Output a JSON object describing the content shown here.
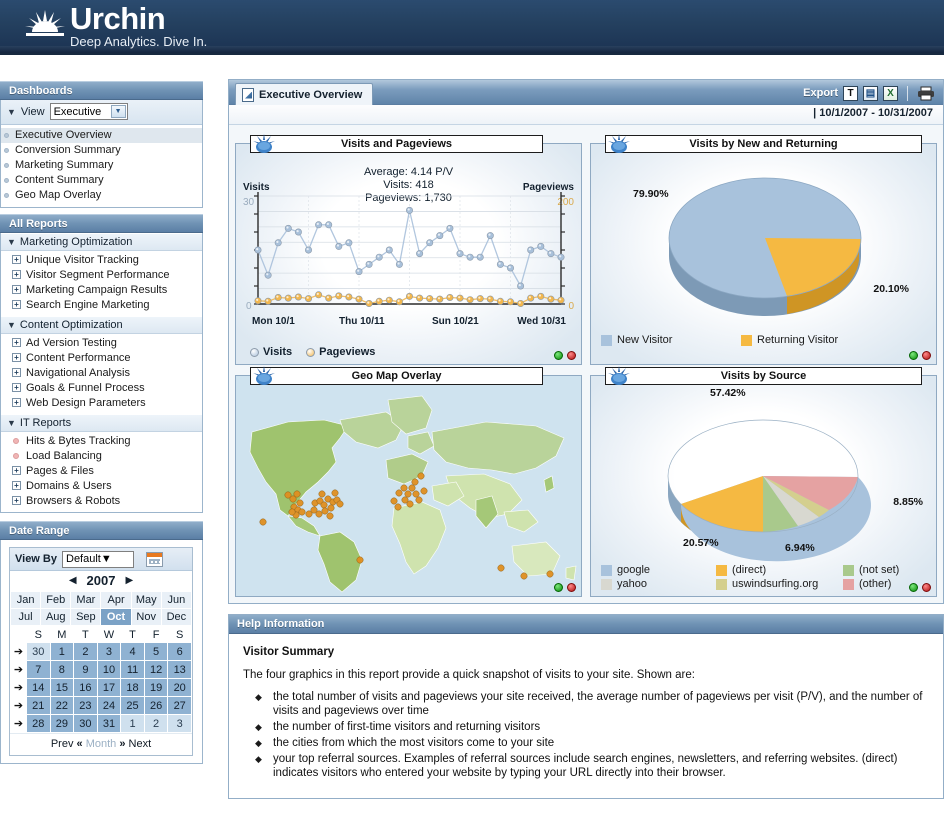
{
  "brand": {
    "name": "Urchin",
    "tagline": "Deep Analytics. Dive In.",
    "logo_icon": "sun-burst-icon"
  },
  "sidebar": {
    "dashboards": {
      "header": "Dashboards",
      "view_label": "View",
      "view_select_value": "Executive",
      "items": [
        {
          "label": "Executive Overview",
          "active": true
        },
        {
          "label": "Conversion Summary",
          "active": false
        },
        {
          "label": "Marketing Summary",
          "active": false
        },
        {
          "label": "Content Summary",
          "active": false
        },
        {
          "label": "Geo Map Overlay",
          "active": false
        }
      ]
    },
    "all_reports": {
      "header": "All Reports",
      "groups": [
        {
          "label": "Marketing Optimization",
          "expanded": true,
          "items": [
            {
              "label": "Unique Visitor Tracking",
              "marker": "plus"
            },
            {
              "label": "Visitor Segment Performance",
              "marker": "plus"
            },
            {
              "label": "Marketing Campaign Results",
              "marker": "plus"
            },
            {
              "label": "Search Engine Marketing",
              "marker": "plus"
            }
          ]
        },
        {
          "label": "Content Optimization",
          "expanded": true,
          "items": [
            {
              "label": "Ad Version Testing",
              "marker": "plus"
            },
            {
              "label": "Content Performance",
              "marker": "plus"
            },
            {
              "label": "Navigational Analysis",
              "marker": "plus"
            },
            {
              "label": "Goals & Funnel Process",
              "marker": "plus"
            },
            {
              "label": "Web Design Parameters",
              "marker": "plus"
            }
          ]
        },
        {
          "label": "IT Reports",
          "expanded": true,
          "items": [
            {
              "label": "Hits & Bytes Tracking",
              "marker": "dot"
            },
            {
              "label": "Load Balancing",
              "marker": "dot"
            },
            {
              "label": "Pages & Files",
              "marker": "plus"
            },
            {
              "label": "Domains & Users",
              "marker": "plus"
            },
            {
              "label": "Browsers & Robots",
              "marker": "plus"
            }
          ]
        }
      ]
    },
    "date_range": {
      "header": "Date Range",
      "view_by_label": "View By",
      "view_by_value": "Default",
      "calendar_icon": "calendar-icon",
      "year": "2007",
      "prev_year_arrow": "◀",
      "next_year_arrow": "▶",
      "months": [
        "Jan",
        "Feb",
        "Mar",
        "Apr",
        "May",
        "Jun",
        "Jul",
        "Aug",
        "Sep",
        "Oct",
        "Nov",
        "Dec"
      ],
      "selected_month": "Oct",
      "weekday_headers": [
        "S",
        "M",
        "T",
        "W",
        "T",
        "F",
        "S"
      ],
      "weeks": [
        {
          "arrow": "➔",
          "days": [
            {
              "n": "30",
              "state": "other"
            },
            {
              "n": "1",
              "state": "in"
            },
            {
              "n": "2",
              "state": "in"
            },
            {
              "n": "3",
              "state": "in"
            },
            {
              "n": "4",
              "state": "in"
            },
            {
              "n": "5",
              "state": "in"
            },
            {
              "n": "6",
              "state": "in"
            }
          ]
        },
        {
          "arrow": "➔",
          "days": [
            {
              "n": "7",
              "state": "in"
            },
            {
              "n": "8",
              "state": "in"
            },
            {
              "n": "9",
              "state": "in"
            },
            {
              "n": "10",
              "state": "in"
            },
            {
              "n": "11",
              "state": "in"
            },
            {
              "n": "12",
              "state": "in"
            },
            {
              "n": "13",
              "state": "in"
            }
          ]
        },
        {
          "arrow": "➔",
          "days": [
            {
              "n": "14",
              "state": "in"
            },
            {
              "n": "15",
              "state": "in"
            },
            {
              "n": "16",
              "state": "in"
            },
            {
              "n": "17",
              "state": "in"
            },
            {
              "n": "18",
              "state": "in"
            },
            {
              "n": "19",
              "state": "in"
            },
            {
              "n": "20",
              "state": "in"
            }
          ]
        },
        {
          "arrow": "➔",
          "days": [
            {
              "n": "21",
              "state": "in"
            },
            {
              "n": "22",
              "state": "in"
            },
            {
              "n": "23",
              "state": "in"
            },
            {
              "n": "24",
              "state": "in"
            },
            {
              "n": "25",
              "state": "in"
            },
            {
              "n": "26",
              "state": "in"
            },
            {
              "n": "27",
              "state": "in"
            }
          ]
        },
        {
          "arrow": "➔",
          "days": [
            {
              "n": "28",
              "state": "in"
            },
            {
              "n": "29",
              "state": "in"
            },
            {
              "n": "30",
              "state": "in"
            },
            {
              "n": "31",
              "state": "in"
            },
            {
              "n": "1",
              "state": "other"
            },
            {
              "n": "2",
              "state": "other"
            },
            {
              "n": "3",
              "state": "other"
            }
          ]
        }
      ],
      "footer": {
        "prev": "Prev",
        "prev_chev": "«",
        "unit": "Month",
        "next_chev": "»",
        "next": "Next"
      }
    }
  },
  "main": {
    "tab_label": "Executive Overview",
    "tab_icon": "report-document-icon",
    "export_label": "Export",
    "export_icons": [
      {
        "name": "export-text-icon",
        "glyph": "T"
      },
      {
        "name": "export-pdf-icon",
        "glyph": "▤"
      },
      {
        "name": "export-excel-icon",
        "glyph": "X"
      }
    ],
    "print_icon": "printer-icon",
    "date_range_text": "|  10/1/2007 - 10/31/2007"
  },
  "chart_data": [
    {
      "type": "line",
      "title": "Visits and Pageviews",
      "annotations": [
        "Average: 4.14 P/V",
        "Visits: 418",
        "Pageviews: 1,730"
      ],
      "left_axis_label": "Visits",
      "right_axis_label": "Pageviews",
      "left_axis_max": "30",
      "left_axis_min": "0",
      "right_axis_max": "200",
      "right_axis_min": "0",
      "ylim": [
        0,
        30
      ],
      "y2lim": [
        0,
        200
      ],
      "grid": true,
      "legend": [
        "Visits",
        "Pageviews"
      ],
      "legend_position": "bottom-left",
      "xlabel": "",
      "ylabel": "Visits",
      "tick_labels": [
        "Mon 10/1",
        "Thu 10/11",
        "Sun 10/21",
        "Wed 10/31"
      ],
      "x": [
        "10/1",
        "10/2",
        "10/3",
        "10/4",
        "10/5",
        "10/6",
        "10/7",
        "10/8",
        "10/9",
        "10/10",
        "10/11",
        "10/12",
        "10/13",
        "10/14",
        "10/15",
        "10/16",
        "10/17",
        "10/18",
        "10/19",
        "10/20",
        "10/21",
        "10/22",
        "10/23",
        "10/24",
        "10/25",
        "10/26",
        "10/27",
        "10/28",
        "10/29",
        "10/30",
        "10/31"
      ],
      "series": [
        {
          "name": "Visits",
          "color": "#a8c0da",
          "values": [
            15,
            8,
            17,
            21,
            20,
            15,
            22,
            22,
            16,
            17,
            9,
            11,
            13,
            15,
            11,
            26,
            14,
            17,
            19,
            21,
            14,
            13,
            13,
            19,
            11,
            10,
            5,
            15,
            16,
            14,
            13
          ]
        },
        {
          "name": "Pageviews",
          "color": "#f2b74e",
          "values": [
            6,
            5,
            12,
            11,
            13,
            10,
            17,
            11,
            15,
            13,
            9,
            1,
            5,
            7,
            4,
            14,
            11,
            10,
            9,
            12,
            11,
            8,
            10,
            9,
            5,
            4,
            1,
            11,
            14,
            9,
            7
          ]
        }
      ]
    },
    {
      "type": "pie",
      "title": "Visits by New and Returning",
      "labels": [
        "New Visitor",
        "Returning Visitor"
      ],
      "values": [
        79.9,
        20.1
      ],
      "value_labels": [
        "79.90%",
        "20.10%"
      ],
      "colors": [
        "#a8c2dc",
        "#f5b942"
      ],
      "legend": [
        "New Visitor",
        "Returning Visitor"
      ],
      "legend_position": "bottom"
    },
    {
      "type": "map",
      "title": "Geo Map Overlay",
      "description": "World map with orange visitor markers concentrated in North America and Western Europe"
    },
    {
      "type": "pie",
      "title": "Visits by Source",
      "labels": [
        "google",
        "(direct)",
        "(not set)",
        "yahoo",
        "uswindsurfing.org",
        "(other)"
      ],
      "values": [
        57.42,
        20.57,
        6.94,
        2.2,
        4.02,
        8.85
      ],
      "value_labels": [
        "57.42%",
        "20.57%",
        "6.94%",
        "8.85%"
      ],
      "colors": [
        "#a8c2dc",
        "#f5b942",
        "#a9c98c",
        "#d8d8d0",
        "#d4cf8e",
        "#e5a2a2"
      ],
      "legend": [
        "google",
        "(direct)",
        "(not set)",
        "yahoo",
        "uswindsurfing.org",
        "(other)"
      ],
      "legend_position": "bottom"
    }
  ],
  "help": {
    "header": "Help Information",
    "title": "Visitor Summary",
    "intro": "The four graphics in this report provide a quick snapshot of visits to your site. Shown are:",
    "bullets": [
      "the total number of visits and pageviews your site received, the average number of pageviews per visit (P/V), and the number of visits and pageviews over time",
      "the number of first-time visitors and returning visitors",
      "the cities from which the most visitors come to your site",
      "your top referral sources. Examples of referral sources include search engines, newsletters, and referring websites. (direct) indicates visitors who entered your website by typing your URL directly into their browser."
    ]
  }
}
